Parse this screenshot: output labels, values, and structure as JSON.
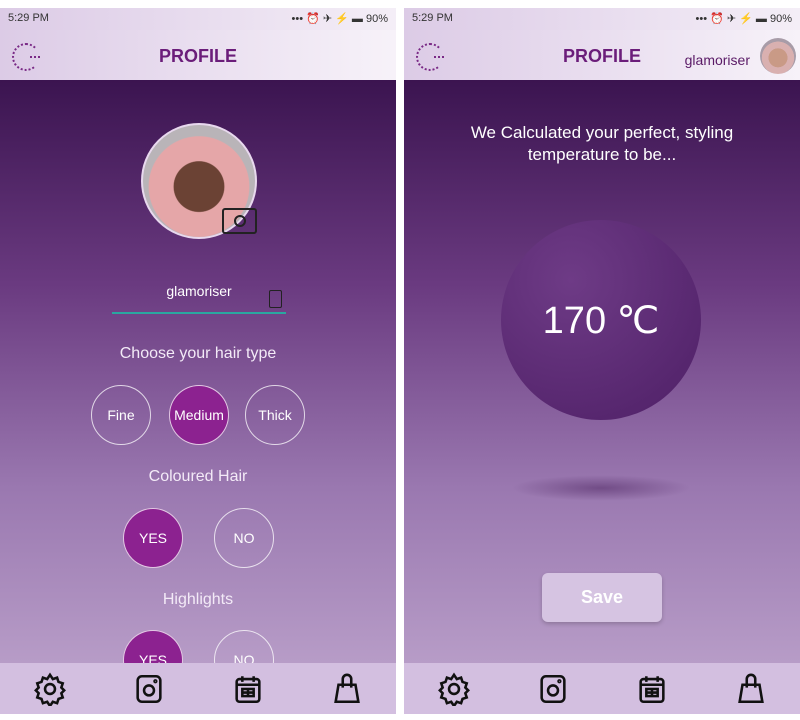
{
  "status": {
    "time": "5:29 PM",
    "battery": "90%",
    "icons": [
      "more-dots-icon",
      "alarm-icon",
      "airplane-icon",
      "charging-icon",
      "battery-icon"
    ]
  },
  "left": {
    "header": {
      "title": "PROFILE"
    },
    "username": "glamoriser",
    "hair_type": {
      "label": "Choose your hair type",
      "options": [
        "Fine",
        "Medium",
        "Thick"
      ],
      "selected": "Medium"
    },
    "coloured": {
      "label": "Coloured Hair",
      "options": [
        "YES",
        "NO"
      ],
      "selected": "YES"
    },
    "highlights": {
      "label": "Highlights",
      "options": [
        "YES",
        "NO"
      ],
      "selected": "YES"
    }
  },
  "right": {
    "header": {
      "title": "PROFILE",
      "username": "glamoriser"
    },
    "message": [
      "We Calculated your perfect, styling",
      "temperature to be..."
    ],
    "temperature": "170 ℃",
    "save_label": "Save"
  },
  "nav": [
    "settings-icon",
    "camera-icon",
    "calendar-icon",
    "shopping-bag-icon"
  ],
  "colors": {
    "accent": "#8c2290",
    "title": "#6b1d7a",
    "underline": "#2aa7a0"
  }
}
